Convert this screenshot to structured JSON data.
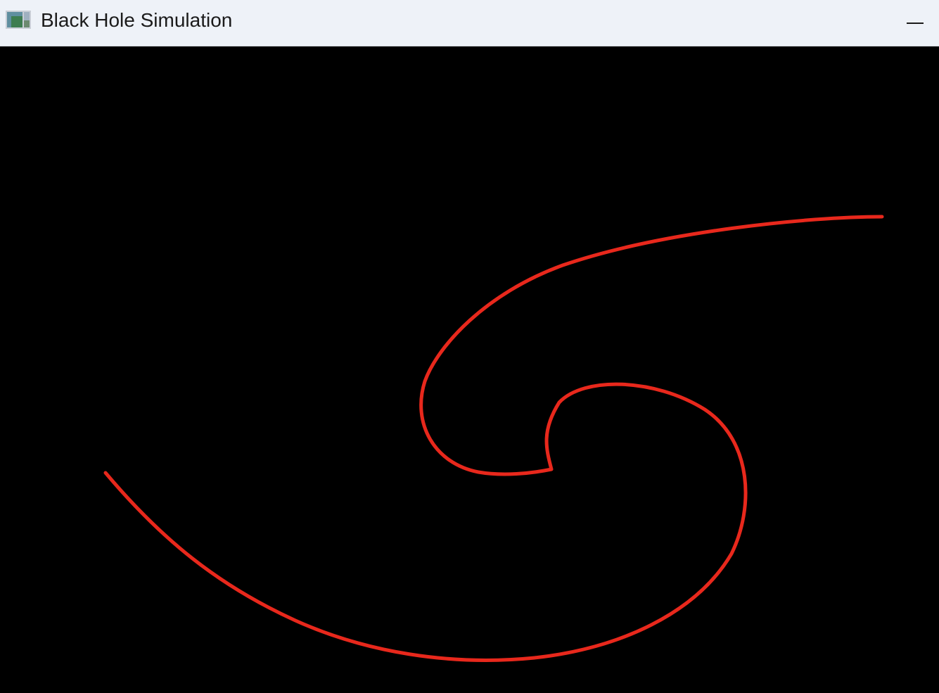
{
  "window": {
    "title": "Black Hole Simulation",
    "icon": "app-window-icon",
    "controls": {
      "minimize_icon": "minimize-icon"
    }
  },
  "canvas": {
    "background_color": "#000000",
    "ray_color": "#e8281c",
    "ray_shape": "spiral-trajectory"
  }
}
